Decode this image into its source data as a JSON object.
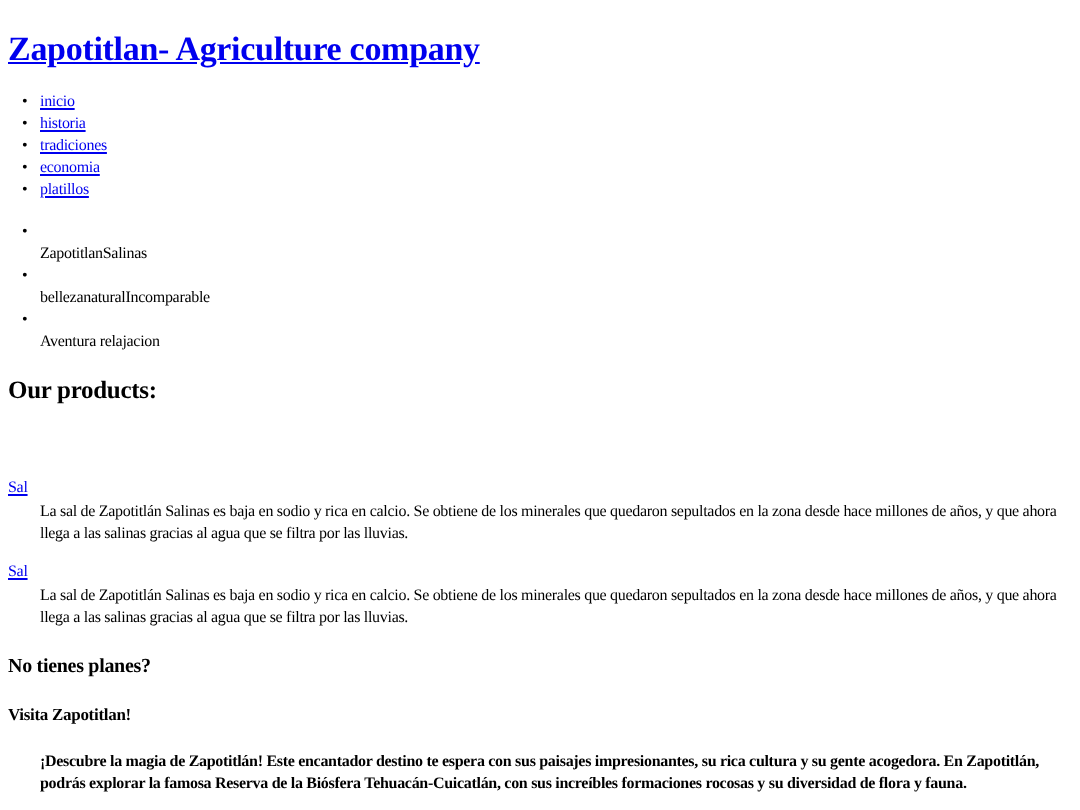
{
  "title": "Zapotitlan- Agriculture company",
  "nav": [
    {
      "bullet": "•",
      "label": "inicio"
    },
    {
      "bullet": "•",
      "label": "historia"
    },
    {
      "bullet": "•",
      "label": "tradiciones"
    },
    {
      "bullet": "•",
      "label": "economia"
    },
    {
      "bullet": "•",
      "label": "platillos"
    }
  ],
  "features": [
    {
      "bullet": "•",
      "text": "ZapotitlanSalinas"
    },
    {
      "bullet": "•",
      "text": "bellezanaturalIncomparable"
    },
    {
      "bullet": "•",
      "text": "Aventura relajacion"
    }
  ],
  "products_heading": "Our products:",
  "products": [
    {
      "link": "Sal",
      "description": "La sal de Zapotitlán Salinas es baja en sodio y rica en calcio. Se obtiene de los minerales que quedaron sepultados en la zona desde hace millones de años, y que ahora llega a las salinas gracias al agua que se filtra por las lluvias."
    },
    {
      "link": "Sal",
      "description": "La sal de Zapotitlán Salinas es baja en sodio y rica en calcio. Se obtiene de los minerales que quedaron sepultados en la zona desde hace millones de años, y que ahora llega a las salinas gracias al agua que se filtra por las lluvias."
    }
  ],
  "plans_heading": "No tienes planes?",
  "visit_heading": "Visita Zapotitlan!",
  "visit_text": "¡Descubre la magia de Zapotitlán! Este encantador destino te espera con sus paisajes impresionantes, su rica cultura y su gente acogedora. En Zapotitlán, podrás explorar la famosa Reserva de la Biósfera Tehuacán-Cuicatlán, con sus increíbles formaciones rocosas y su diversidad de flora y fauna."
}
